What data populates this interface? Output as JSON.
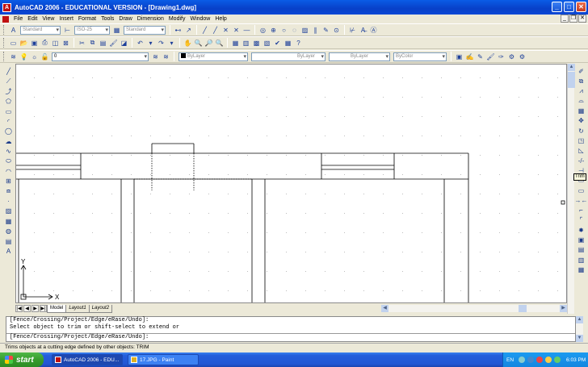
{
  "window": {
    "title": "AutoCAD 2006 - EDUCATIONAL VERSION - [Drawing1.dwg]",
    "min": "_",
    "max": "□",
    "close": "✕"
  },
  "menu": [
    "File",
    "Edit",
    "View",
    "Insert",
    "Format",
    "Tools",
    "Draw",
    "Dimension",
    "Modify",
    "Window",
    "Help"
  ],
  "toolbar": {
    "text_style": "Standard",
    "dim_style": "ISO-25",
    "table_style": "Standard",
    "layer": "0",
    "color": "ByLayer",
    "linetype": "ByLayer",
    "lineweight": "ByLayer",
    "plotstyle": "ByColor"
  },
  "tooltip": "Trim",
  "tabs": [
    "Model",
    "Layout1",
    "Layout2"
  ],
  "command": {
    "line1": "[Fence/Crossing/Project/Edge/eRase/Undo]:",
    "line2": "Select object to trim or shift-select to extend or",
    "input": "[Fence/Crossing/Project/Edge/eRase/Undo]:"
  },
  "status": "Trims objects at a cutting edge defined by other objects:  TRIM",
  "ucs": {
    "x": "X",
    "y": "Y"
  },
  "taskbar": {
    "start": "start",
    "tasks": [
      "AutoCAD 2006 - EDU...",
      "17.JPG - Paint"
    ],
    "lang": "EN",
    "time": "6:03 PM"
  },
  "colors": {
    "titlebar": "#0a5ce6",
    "taskbar": "#245edb",
    "start": "#379c2c"
  }
}
